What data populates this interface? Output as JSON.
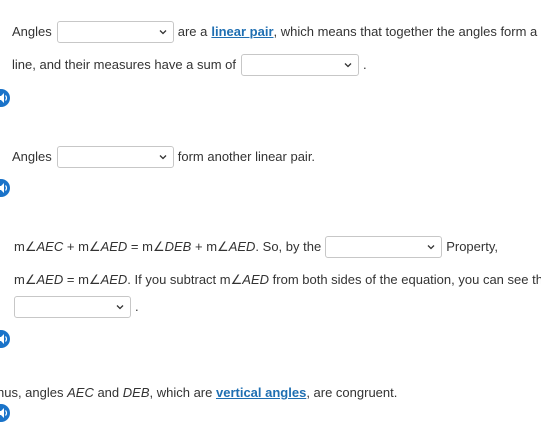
{
  "para1": {
    "line1_prefix": "Angles",
    "line1_middle": "are a",
    "line1_link": "linear pair",
    "line1_suffix": ", which means that together the angles form a str",
    "line2_prefix": "line, and their measures have a sum of",
    "line2_suffix": "."
  },
  "para2": {
    "prefix": "Angles",
    "suffix": "form another linear pair."
  },
  "para3": {
    "eq1_m1": "m",
    "eq1_a1": "AEC",
    "eq1_plus1": " + ",
    "eq1_m2": "m",
    "eq1_a2": "AED",
    "eq1_eq": " = ",
    "eq1_m3": "m",
    "eq1_a3": "DEB",
    "eq1_plus2": " + ",
    "eq1_m4": "m",
    "eq1_a4": "AED",
    "eq1_tail": ". So, by the",
    "property_label": "Property,",
    "eq2_m1": "m",
    "eq2_a1": "AED",
    "eq2_eq": " = ",
    "eq2_m2": "m",
    "eq2_a2": "AED",
    "eq2_mid": ". If you subtract ",
    "eq2_m3": "m",
    "eq2_a3": "AED",
    "eq2_tail": " from both sides of the equation, you can see th",
    "line3_suffix": "."
  },
  "para4": {
    "prefix": "hus, angles ",
    "angle1": "AEC",
    "and": " and ",
    "angle2": "DEB",
    "middle": ", which are ",
    "link": "vertical angles",
    "suffix": ", are congruent."
  },
  "icons": {
    "audio": "speaker-icon",
    "dropdown": "chevron-down-icon"
  },
  "colors": {
    "link": "#1f6fb2",
    "audio_button": "#1a73c9",
    "dropdown_border": "#c7c7c7"
  }
}
